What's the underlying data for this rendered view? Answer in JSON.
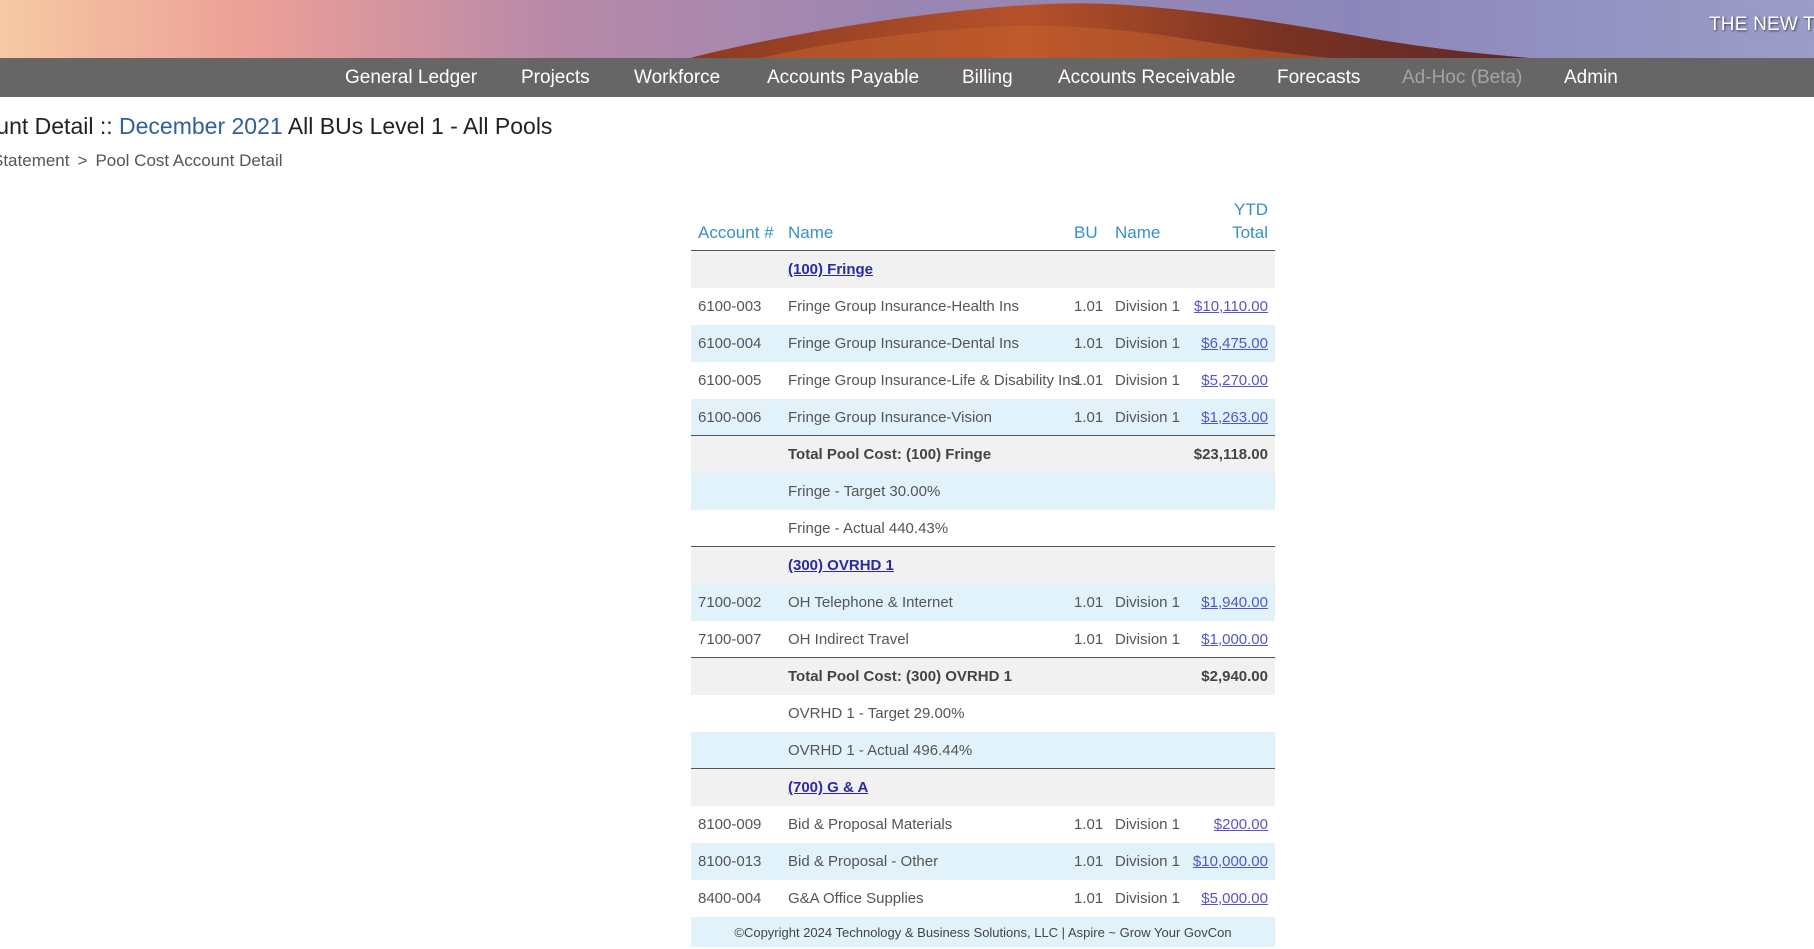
{
  "banner": {
    "title": "THE NEW T"
  },
  "nav": [
    {
      "label": "General Ledger",
      "disabled": false
    },
    {
      "label": "Projects",
      "disabled": false
    },
    {
      "label": "Workforce",
      "disabled": false
    },
    {
      "label": "Accounts Payable",
      "disabled": false
    },
    {
      "label": "Billing",
      "disabled": false
    },
    {
      "label": "Accounts Receivable",
      "disabled": false
    },
    {
      "label": "Forecasts",
      "disabled": false
    },
    {
      "label": "Ad-Hoc (Beta)",
      "disabled": true
    },
    {
      "label": "Admin",
      "disabled": false
    }
  ],
  "page": {
    "title_prefix": "count Detail ::",
    "period": "December 2021",
    "scope": "All BUs Level 1 - All Pools",
    "breadcrumb": [
      "Statement",
      "Pool Cost Account Detail"
    ],
    "breadcrumb_sep": ">"
  },
  "table": {
    "headers": {
      "account": "Account #",
      "name": "Name",
      "bu": "BU",
      "bu_name": "Name",
      "ytd_line1": "YTD",
      "ytd_line2": "Total"
    },
    "rows": [
      {
        "type": "pool",
        "name": "(100) Fringe"
      },
      {
        "type": "account",
        "account": "6100-003",
        "name": "Fringe Group Insurance-Health Ins",
        "bu": "1.01",
        "bu_name": "Division 1",
        "total": "$10,110.00"
      },
      {
        "type": "account",
        "account": "6100-004",
        "name": "Fringe Group Insurance-Dental Ins",
        "bu": "1.01",
        "bu_name": "Division 1",
        "total": "$6,475.00"
      },
      {
        "type": "account",
        "account": "6100-005",
        "name": "Fringe Group Insurance-Life & Disability Ins",
        "bu": "1.01",
        "bu_name": "Division 1",
        "total": "$5,270.00"
      },
      {
        "type": "account",
        "account": "6100-006",
        "name": "Fringe Group Insurance-Vision",
        "bu": "1.01",
        "bu_name": "Division 1",
        "total": "$1,263.00"
      },
      {
        "type": "total",
        "name": "Total Pool Cost: (100) Fringe",
        "total": "$23,118.00"
      },
      {
        "type": "note",
        "name": "Fringe - Target 30.00%"
      },
      {
        "type": "note",
        "name": "Fringe - Actual 440.43%"
      },
      {
        "type": "pool",
        "name": "(300) OVRHD 1"
      },
      {
        "type": "account",
        "account": "7100-002",
        "name": "OH Telephone & Internet",
        "bu": "1.01",
        "bu_name": "Division 1",
        "total": "$1,940.00"
      },
      {
        "type": "account",
        "account": "7100-007",
        "name": "OH Indirect Travel",
        "bu": "1.01",
        "bu_name": "Division 1",
        "total": "$1,000.00"
      },
      {
        "type": "total",
        "name": "Total Pool Cost: (300) OVRHD 1",
        "total": "$2,940.00"
      },
      {
        "type": "note",
        "name": "OVRHD 1 - Target 29.00%"
      },
      {
        "type": "note",
        "name": "OVRHD 1 - Actual 496.44%"
      },
      {
        "type": "pool",
        "name": "(700) G & A"
      },
      {
        "type": "account",
        "account": "8100-009",
        "name": "Bid & Proposal Materials",
        "bu": "1.01",
        "bu_name": "Division 1",
        "total": "$200.00"
      },
      {
        "type": "account",
        "account": "8100-013",
        "name": "Bid & Proposal - Other",
        "bu": "1.01",
        "bu_name": "Division 1",
        "total": "$10,000.00"
      },
      {
        "type": "account",
        "account": "8400-004",
        "name": "G&A Office Supplies",
        "bu": "1.01",
        "bu_name": "Division 1",
        "total": "$5,000.00"
      }
    ]
  },
  "footer": {
    "text": "©Copyright 2024 Technology & Business Solutions, LLC  |  Aspire ~ Grow Your GovCon"
  },
  "colors": {
    "nav_bg": "#666666",
    "header_blue": "#3591c8",
    "period_blue": "#2f5f9c",
    "row_blue": "#e1f2fb",
    "row_gray": "#f1f1f1",
    "link": "#5555c8"
  }
}
